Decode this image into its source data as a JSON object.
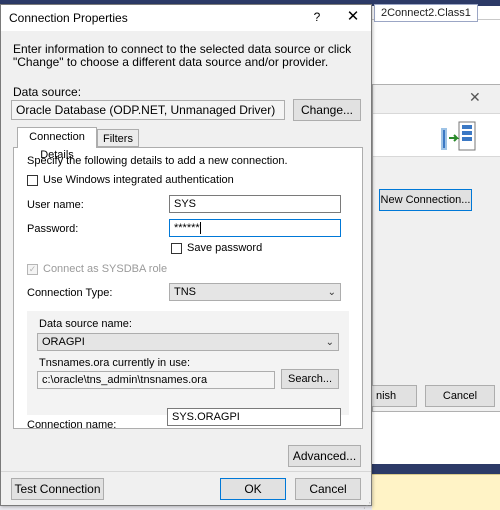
{
  "background": {
    "tab_label": "2Connect2.Class1",
    "new_connection_label": "New Connection...",
    "finish_label": "nish",
    "cancel_label": "Cancel"
  },
  "dialog": {
    "title": "Connection Properties",
    "help_label": "?",
    "close_label": "✕",
    "intro": "Enter information to connect to the selected data source or click \"Change\" to choose a different data source and/or provider.",
    "data_source_label": "Data source:",
    "data_source_value": "Oracle Database (ODP.NET, Unmanaged Driver)",
    "change_label": "Change...",
    "tabs": [
      {
        "label": "Connection Details",
        "active": true
      },
      {
        "label": "Filters",
        "active": false
      }
    ],
    "details": {
      "specify_text": "Specify the following details to add a new connection.",
      "windows_auth_label": "Use Windows integrated authentication",
      "windows_auth_checked": false,
      "username_label": "User name:",
      "username_value": "SYS",
      "password_label": "Password:",
      "password_value": "******",
      "save_password_label": "Save password",
      "save_password_checked": false,
      "sysdba_label": "Connect as SYSDBA role",
      "sysdba_checked": true,
      "conn_type_label": "Connection Type:",
      "conn_type_value": "TNS",
      "ds_name_label": "Data source name:",
      "ds_name_value": "ORAGPI",
      "tnsnames_label": "Tnsnames.ora currently in use:",
      "tnsnames_value": "c:\\oracle\\tns_admin\\tnsnames.ora",
      "search_label": "Search...",
      "conn_name_label": "Connection name:",
      "conn_name_value": "SYS.ORAGPI"
    },
    "advanced_label": "Advanced...",
    "test_label": "Test Connection",
    "ok_label": "OK",
    "cancel_label": "Cancel"
  },
  "colors": {
    "accent": "#0078d7",
    "dialog_bg": "#f0f0f0",
    "ide_dark": "#2c3a67",
    "status_yellow": "#fff3c6"
  }
}
